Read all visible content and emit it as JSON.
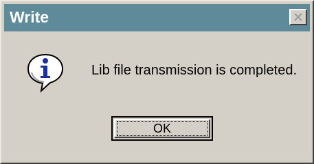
{
  "window": {
    "title": "Write",
    "close_icon": "close-icon"
  },
  "dialog": {
    "icon": "info-icon",
    "message": "Lib file transmission is completed.",
    "ok_label": "OK"
  },
  "colors": {
    "titlebar": "#5f8a9a",
    "face": "#d4d0c8",
    "info_blue": "#1c2fa0"
  }
}
